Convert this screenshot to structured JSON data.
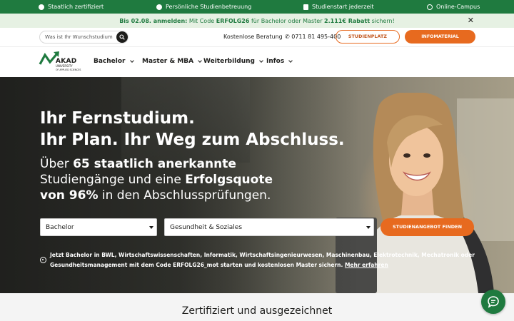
{
  "topbar": {
    "items": [
      {
        "label": "Staatlich zertifiziert",
        "icon": "certificate-icon"
      },
      {
        "label": "Persönliche Studienbetreuung",
        "icon": "people-icon"
      },
      {
        "label": "Studienstart jederzeit",
        "icon": "flag-icon"
      },
      {
        "label": "Online-Campus",
        "icon": "globe-icon"
      }
    ],
    "color": "#1f7a3f"
  },
  "promo": {
    "part1": "Bis 02.08. anmelden:",
    "part2": " Mit Code ",
    "code": "ERFOLG26",
    "part3": " für Bachelor oder Master ",
    "discount": "2.111€ Rabatt",
    "part4": " sichern!",
    "close": "✕"
  },
  "header": {
    "search_placeholder": "Was ist Ihr Wunschstudium?",
    "consult": "Kostenlose Beratung",
    "phone": "0711 81 495-400",
    "btn_secure": "STUDIENPLATZ SICHERN",
    "btn_info": "INFOMATERIAL ANFORDERN",
    "accent": "#e76a1f"
  },
  "logo": {
    "name": "AKAD",
    "line1": "UNIVERSITY",
    "line2": "OF APPLIED SCIENCES"
  },
  "nav": {
    "items": [
      "Bachelor",
      "Master & MBA",
      "Weiterbildung",
      "Infos"
    ]
  },
  "hero": {
    "title1": "Ihr Fernstudium.",
    "title2": "Ihr Plan. Ihr Weg zum Abschluss.",
    "sub1a": "Über ",
    "sub1b": "65 staatlich anerkannte",
    "sub2a": "Studiengänge und eine ",
    "sub2b": "Erfolgsquote",
    "sub3a": "von 96%",
    "sub3b": " in den Abschlussprüfungen.",
    "select1": "Bachelor",
    "select2": "Gesundheit & Soziales",
    "find": "STUDIENANGEBOT FINDEN",
    "note1": "Jetzt Bachelor in BWL, Wirtschaftswissenschaften, Informatik, Wirtschaftsingenieurwesen, Maschinenbau, Elektrotechnik, Mechatronik oder",
    "note2": "Gesundheitsmanagement mit dem Code ERFOLG26_mot starten und kostenlosen Master sichern.",
    "more": "Mehr erfahren"
  },
  "cert": {
    "title": "Zertifiziert und ausgezeichnet"
  }
}
